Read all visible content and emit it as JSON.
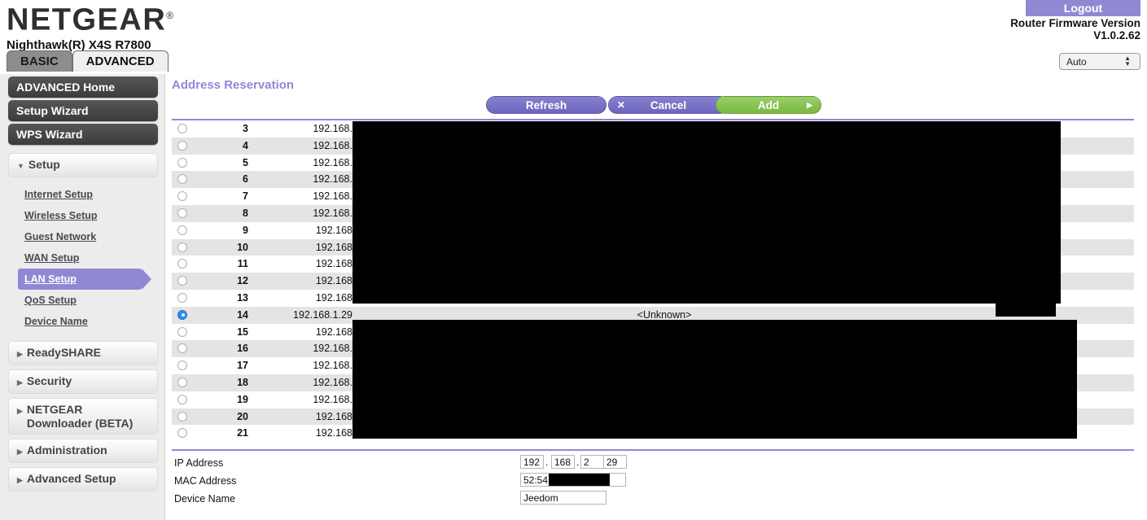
{
  "header": {
    "logo": "NETGEAR",
    "logo_mark": "®",
    "model": "Nighthawk(R) X4S R7800",
    "logout_label": "Logout",
    "firmware_label": "Router Firmware Version",
    "firmware_version": "V1.0.2.62",
    "language_selected": "Auto",
    "logout_color": "#8f89d4"
  },
  "tabs": [
    {
      "label": "BASIC",
      "active": false
    },
    {
      "label": "ADVANCED",
      "active": true
    }
  ],
  "sidebar": {
    "primary": [
      {
        "label": "ADVANCED Home",
        "style": "dark"
      },
      {
        "label": "Setup Wizard",
        "style": "dark"
      },
      {
        "label": "WPS Wizard",
        "style": "dark"
      }
    ],
    "setup_group": {
      "label": "Setup",
      "caret": "▼",
      "expanded": true,
      "items": [
        {
          "label": "Internet Setup",
          "active": false
        },
        {
          "label": "Wireless Setup",
          "active": false
        },
        {
          "label": "Guest Network",
          "active": false
        },
        {
          "label": "WAN Setup",
          "active": false
        },
        {
          "label": "LAN Setup",
          "active": true
        },
        {
          "label": "QoS Setup",
          "active": false
        },
        {
          "label": "Device Name",
          "active": false
        }
      ]
    },
    "collapsed_groups": [
      {
        "label": "ReadySHARE",
        "caret": "▶",
        "two_line": false
      },
      {
        "label": "Security",
        "caret": "▶",
        "two_line": false
      },
      {
        "label": "NETGEAR\nDownloader (BETA)",
        "caret": "▶",
        "two_line": true
      },
      {
        "label": "Administration",
        "caret": "▶",
        "two_line": false
      },
      {
        "label": "Advanced Setup",
        "caret": "▶",
        "two_line": false
      }
    ],
    "active_color": "#8f89d4"
  },
  "main": {
    "section_title": "Address Reservation",
    "buttons": {
      "refresh": "Refresh",
      "cancel": "Cancel",
      "cancel_icon": "✕",
      "add": "Add",
      "add_icon": "▶"
    },
    "divider_color": "#8f89d4",
    "table": {
      "rows": [
        {
          "num": "3",
          "ip": "192.168.",
          "name": "",
          "mac": "",
          "selected": false
        },
        {
          "num": "4",
          "ip": "192.168.",
          "name": "",
          "mac": "",
          "selected": false
        },
        {
          "num": "5",
          "ip": "192.168.",
          "name": "",
          "mac": "",
          "selected": false
        },
        {
          "num": "6",
          "ip": "192.168.",
          "name": "",
          "mac": "",
          "selected": false
        },
        {
          "num": "7",
          "ip": "192.168.",
          "name": "",
          "mac": "",
          "selected": false
        },
        {
          "num": "8",
          "ip": "192.168.",
          "name": "",
          "mac": "",
          "selected": false
        },
        {
          "num": "9",
          "ip": "192.168",
          "name": "",
          "mac": "",
          "selected": false
        },
        {
          "num": "10",
          "ip": "192.168",
          "name": "",
          "mac": "",
          "selected": false
        },
        {
          "num": "11",
          "ip": "192.168",
          "name": "",
          "mac": "",
          "selected": false
        },
        {
          "num": "12",
          "ip": "192.168",
          "name": "",
          "mac": "",
          "selected": false
        },
        {
          "num": "13",
          "ip": "192.168",
          "name": "",
          "mac": "",
          "selected": false
        },
        {
          "num": "14",
          "ip": "192.168.1.29",
          "name": "<Unknown>",
          "mac": "52:54",
          "selected": true
        },
        {
          "num": "15",
          "ip": "192.168",
          "name": "",
          "mac": "",
          "selected": false
        },
        {
          "num": "16",
          "ip": "192.168.",
          "name": "",
          "mac": "",
          "selected": false
        },
        {
          "num": "17",
          "ip": "192.168.",
          "name": "",
          "mac": "",
          "selected": false
        },
        {
          "num": "18",
          "ip": "192.168.",
          "name": "",
          "mac": "",
          "selected": false
        },
        {
          "num": "19",
          "ip": "192.168.",
          "name": "",
          "mac": "",
          "selected": false
        },
        {
          "num": "20",
          "ip": "192.168",
          "name": "",
          "mac": "",
          "selected": false
        },
        {
          "num": "21",
          "ip": "192.168",
          "name": "",
          "mac": "",
          "selected": false
        }
      ]
    },
    "form": {
      "ip_label": "IP Address",
      "ip_octet_1": "192",
      "ip_octet_2": "168",
      "ip_octet_3": "2",
      "ip_octet_4": "29",
      "separator": ".",
      "mac_label": "MAC Address",
      "mac_value": "52:54:",
      "device_label": "Device Name",
      "device_value": "Jeedom"
    }
  }
}
